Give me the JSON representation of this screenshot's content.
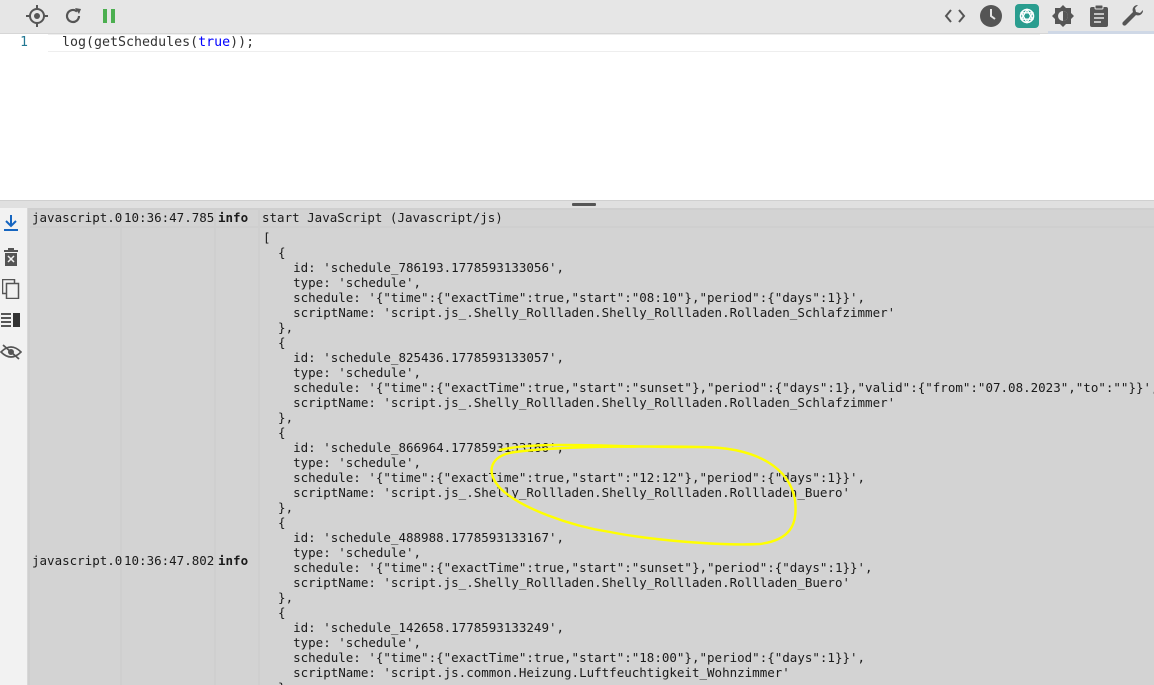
{
  "toolbar": {
    "left_icons": [
      "crosshair-icon",
      "refresh-icon",
      "pause-icon"
    ],
    "right_icons": [
      "code-icon",
      "clock-icon",
      "chatgpt-icon",
      "gear-icon",
      "clipboard-icon",
      "wrench-icon"
    ],
    "colors": {
      "pause": "#4caf50",
      "chatgpt_bg": "#2a9d8f",
      "icon": "#555555"
    }
  },
  "editor": {
    "line_number": "1",
    "code_before": "log(getSchedules(",
    "code_keyword": "true",
    "code_after": "));"
  },
  "log_side_icons": [
    "scroll-down-icon",
    "clear-log-icon",
    "copy-icon",
    "table-view-icon",
    "hide-icon"
  ],
  "log": {
    "row1": {
      "source": "javascript.0",
      "time": "10:36:47.785",
      "severity": "info",
      "message": "start JavaScript (Javascript/js)"
    },
    "row2": {
      "source": "javascript.0",
      "time": "10:36:47.802",
      "severity": "info",
      "lines": [
        "[",
        "  {",
        "    id: 'schedule_786193.1778593133056',",
        "    type: 'schedule',",
        "    schedule: '{\"time\":{\"exactTime\":true,\"start\":\"08:10\"},\"period\":{\"days\":1}}',",
        "    scriptName: 'script.js_.Shelly_Rollladen.Shelly_Rollladen.Rolladen_Schlafzimmer'",
        "  },",
        "  {",
        "    id: 'schedule_825436.1778593133057',",
        "    type: 'schedule',",
        "    schedule: '{\"time\":{\"exactTime\":true,\"start\":\"sunset\"},\"period\":{\"days\":1},\"valid\":{\"from\":\"07.08.2023\",\"to\":\"\"}}',",
        "    scriptName: 'script.js_.Shelly_Rollladen.Shelly_Rollladen.Rolladen_Schlafzimmer'",
        "  },",
        "  {",
        "    id: 'schedule_866964.1778593133166',",
        "    type: 'schedule',",
        "    schedule: '{\"time\":{\"exactTime\":true,\"start\":\"12:12\"},\"period\":{\"days\":1}}',",
        "    scriptName: 'script.js_.Shelly_Rollladen.Shelly_Rollladen.Rollladen_Buero'",
        "  },",
        "  {",
        "    id: 'schedule_488988.1778593133167',",
        "    type: 'schedule',",
        "    schedule: '{\"time\":{\"exactTime\":true,\"start\":\"sunset\"},\"period\":{\"days\":1}}',",
        "    scriptName: 'script.js_.Shelly_Rollladen.Shelly_Rollladen.Rollladen_Buero'",
        "  },",
        "  {",
        "    id: 'schedule_142658.1778593133249',",
        "    type: 'schedule',",
        "    schedule: '{\"time\":{\"exactTime\":true,\"start\":\"18:00\"},\"period\":{\"days\":1}}',",
        "    scriptName: 'script.js.common.Heizung.Luftfeuchtigkeit_Wohnzimmer'",
        "  },"
      ]
    }
  },
  "annotation": {
    "color": "#ffff00"
  }
}
